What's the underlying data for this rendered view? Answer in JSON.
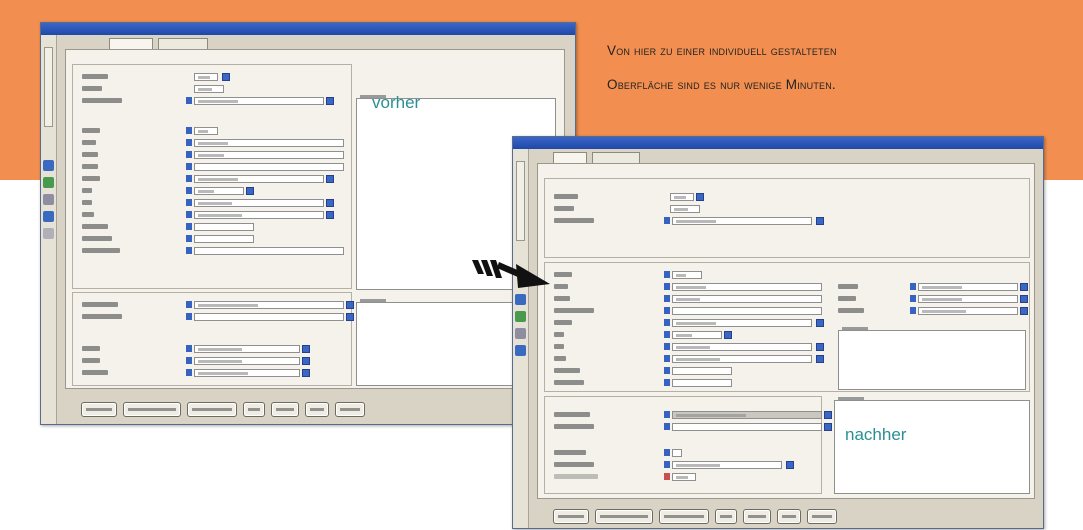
{
  "banner": {
    "color": "#f28f50",
    "line1": "Von hier zu einer individuell gestalteten",
    "line2": "Oberfläche sind es nur wenige Minuten."
  },
  "label_before": "vorher",
  "label_after": "nachher",
  "arrow_icon": "striped-arrow-right",
  "accent": "#2a8f95"
}
